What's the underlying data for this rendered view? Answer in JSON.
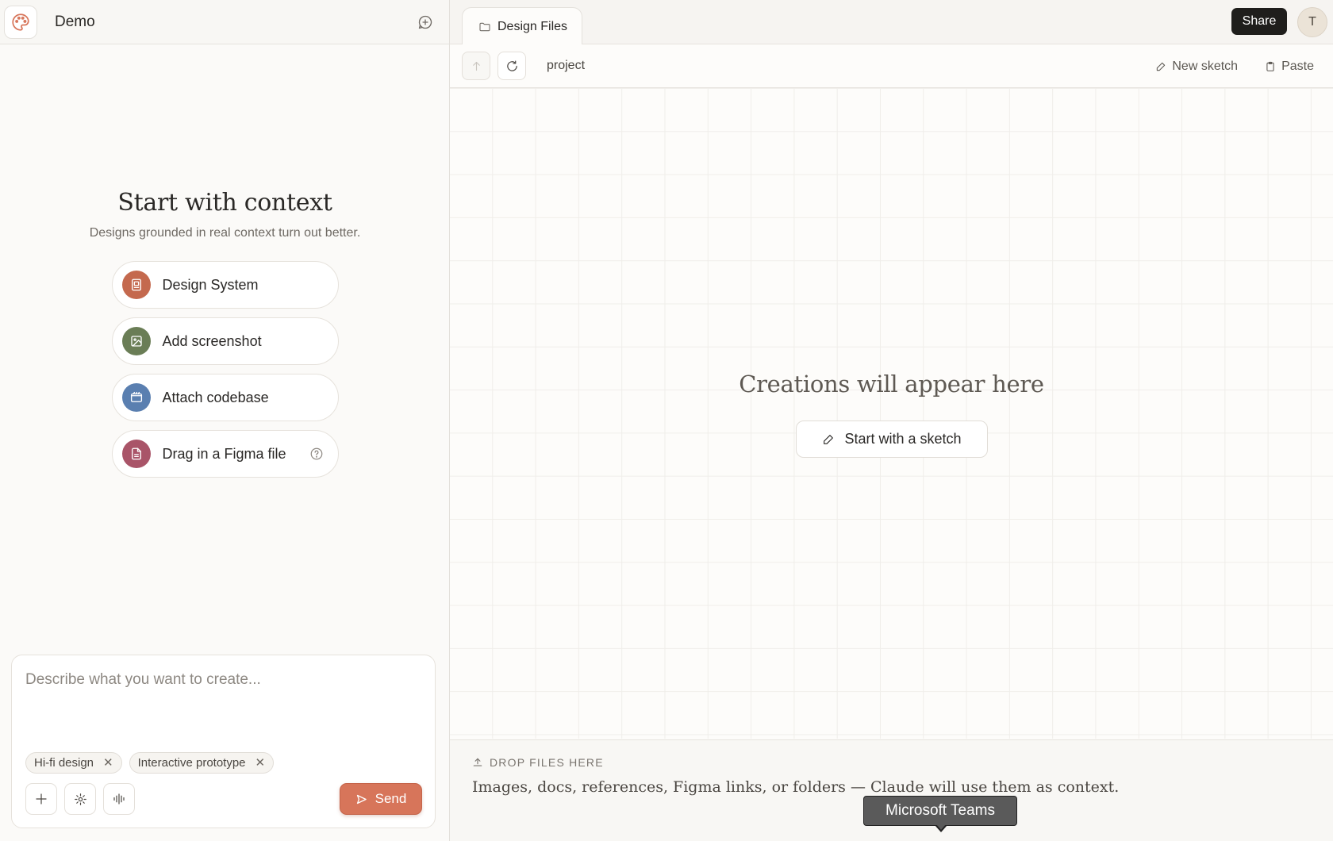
{
  "left": {
    "project_name": "Demo",
    "context_title": "Start with context",
    "context_subtitle": "Designs grounded in real context turn out better.",
    "options": [
      {
        "label": "Design System",
        "icon": "book-icon",
        "color": "#c4694e"
      },
      {
        "label": "Add screenshot",
        "icon": "image-icon",
        "color": "#6a7d56"
      },
      {
        "label": "Attach codebase",
        "icon": "code-folder-icon",
        "color": "#5a7fb0"
      },
      {
        "label": "Drag in a Figma file",
        "icon": "file-icon",
        "color": "#a95468"
      }
    ],
    "composer": {
      "placeholder": "Describe what you want to create...",
      "chips": [
        "Hi-fi design",
        "Interactive prototype"
      ],
      "send_label": "Send"
    }
  },
  "right": {
    "tab_label": "Design Files",
    "share_label": "Share",
    "avatar_initial": "T",
    "path": "project",
    "new_sketch_label": "New sketch",
    "paste_label": "Paste",
    "empty_title": "Creations will appear here",
    "sketch_button_label": "Start with a sketch",
    "drop_title": "DROP FILES HERE",
    "drop_text": "Images, docs, references, Figma links, or folders — Claude will use them as context."
  },
  "tooltip": "Microsoft Teams",
  "colors": {
    "accent": "#d7755a",
    "share_bg": "#1f1e1c"
  }
}
